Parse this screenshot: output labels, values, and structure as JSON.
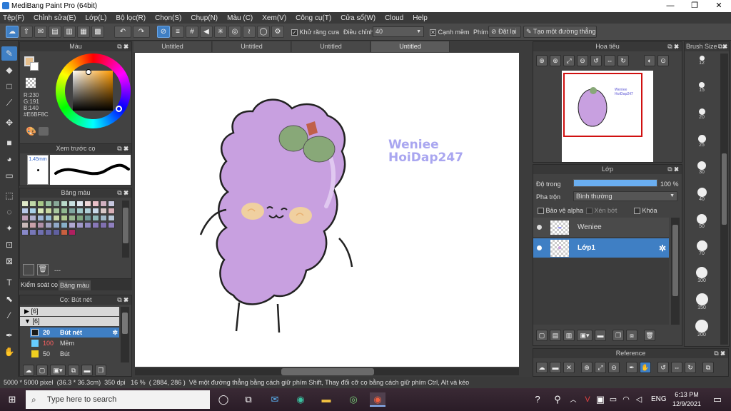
{
  "window": {
    "title": "MediBang Paint Pro (64bit)",
    "minimize": "—",
    "restore": "❐",
    "close": "✕"
  },
  "menu": [
    "Tệp(F)",
    "Chỉnh sửa(E)",
    "Lớp(L)",
    "Bộ lọc(R)",
    "Chọn(S)",
    "Chụp(N)",
    "Màu (C)",
    "Xem(V)",
    "Công cụ(T)",
    "Cửa sổ(W)",
    "Cloud",
    "Help"
  ],
  "toolbar": {
    "antialias_label": "Khử răng cưa",
    "adjust_label": "Điều chỉnh",
    "adjust_value": "40",
    "edge_label": "Cạnh mềm",
    "key_label": "Phím",
    "reset_label": "Đặt lại",
    "straight_label": "Tạo một đường thẳng"
  },
  "color_panel": {
    "title": "Màu",
    "r": "R:230",
    "g": "G:191",
    "b": "B:140",
    "hex": "#E6BF8C",
    "current_color": "#E6BF8C"
  },
  "brush_preview": {
    "title": "Xem trước cọ",
    "size": "1.45mm"
  },
  "palette": {
    "title": "Bảng màu",
    "extra": "---",
    "colors": [
      "#dfe8c8",
      "#bfd8a8",
      "#a8c888",
      "#98c0a0",
      "#88a898",
      "#b8d8c8",
      "#c8e0e0",
      "#e0e8f0",
      "#f0d8d8",
      "#e8c0c8",
      "#d0b0c0",
      "#c8c8e0",
      "#b8c8e8",
      "#a8d0e8",
      "#d8e8b8",
      "#c8d8a0",
      "#a8c8a0",
      "#90b890",
      "#80a8a0",
      "#a0c8c8",
      "#b0d0d8",
      "#c8d8e8",
      "#d8c8c8",
      "#d8b0b8",
      "#c0a0b8",
      "#b0b0d0",
      "#a0b8d8",
      "#98c0d8",
      "#c8d8a8",
      "#b0c890",
      "#98b890",
      "#80a880",
      "#709898",
      "#90b8b8",
      "#a0b8c8",
      "#b8c8d8",
      "#c8b8b8",
      "#c8a0a8",
      "#b090a8",
      "#a0a0c0",
      "#90a8c8",
      "#88b0c8",
      "#b0a8d0",
      "#a098c8",
      "#9088c0",
      "#8878b8",
      "#8070b0",
      "#9080c0",
      "#8888c8",
      "#7878b8",
      "#7070b0",
      "#6868a8",
      "#6060a0",
      "#c86040",
      "#b02060"
    ]
  },
  "left_tabs": {
    "tab1": "Kiểm soát cọ",
    "tab2": "Bảng màu"
  },
  "brush_panel": {
    "title": "Cọ: Bút nét",
    "groups": [
      {
        "label": "[6]"
      },
      {
        "label": "[6]"
      }
    ],
    "items": [
      {
        "size": "20",
        "name": "Bút nét",
        "color": "#1a1a1a"
      },
      {
        "size": "100",
        "name": "Mềm",
        "color": "#66ccff"
      },
      {
        "size": "50",
        "name": "Bút",
        "color": "#f0d020"
      }
    ]
  },
  "tabs": [
    "Untitled",
    "Untitled",
    "Untitled",
    "Untitled"
  ],
  "canvas": {
    "watermark_line1": "Weniee",
    "watermark_line2": "HoiDap247"
  },
  "navigator": {
    "title": "Hoa tiêu",
    "mini_line1": "Weniee",
    "mini_line2": "HoiDap247"
  },
  "layers": {
    "title": "Lớp",
    "opacity_label": "Độ trong",
    "opacity_value": "100 %",
    "opacity": 100,
    "blend_label": "Pha trộn",
    "blend_value": "Bình thường",
    "protect_alpha": "Bảo vệ alpha",
    "clipping": "Xén bớt",
    "lock": "Khóa",
    "items": [
      {
        "name": "Weniee"
      },
      {
        "name": "Lớp1"
      }
    ]
  },
  "reference": {
    "title": "Reference"
  },
  "brush_size": {
    "title": "Brush Size",
    "sizes": [
      "12",
      "15",
      "20",
      "25",
      "30",
      "40",
      "50",
      "70",
      "100",
      "150",
      "200"
    ]
  },
  "status": {
    "dims": "5000 * 5000 pixel",
    "cm": "(36.3 * 36.3cm)",
    "dpi": "350 dpi",
    "zoom": "16 %",
    "coords": "( 2884, 286 )",
    "hint": "Vẽ một đường thẳng bằng cách giữ phím Shift, Thay đổi cỡ cọ bằng cách giữ phím Ctrl, Alt và kéo"
  },
  "taskbar": {
    "search_placeholder": "Type here to search",
    "lang": "ENG",
    "time": "6:13 PM",
    "date": "12/9/2021"
  }
}
